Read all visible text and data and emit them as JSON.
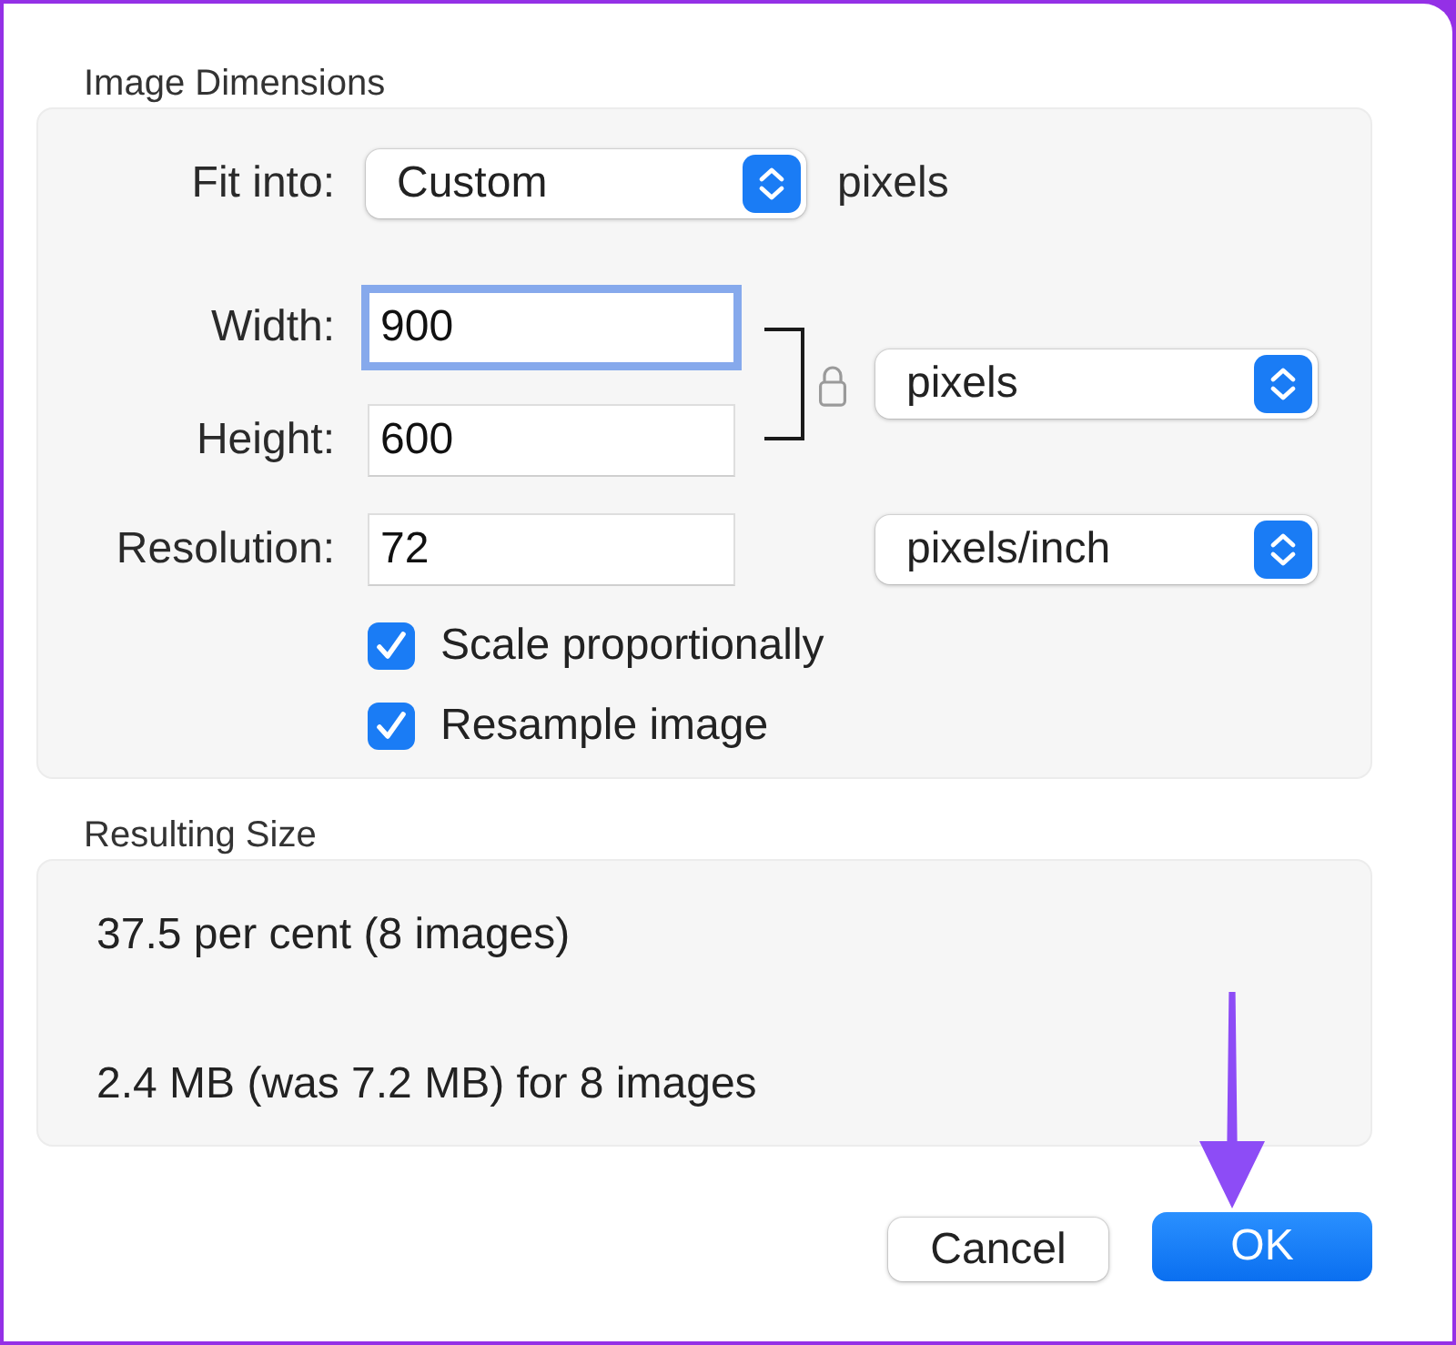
{
  "image_dimensions": {
    "title": "Image Dimensions",
    "fit_into": {
      "label": "Fit into:",
      "value": "Custom",
      "suffix": "pixels"
    },
    "fields": [
      {
        "label": "Width:",
        "value": "900",
        "focused": true
      },
      {
        "label": "Height:",
        "value": "600",
        "focused": false
      },
      {
        "label": "Resolution:",
        "value": "72",
        "focused": false
      }
    ],
    "size_unit": "pixels",
    "resolution_unit": "pixels/inch",
    "options": [
      {
        "label": "Scale proportionally",
        "checked": true
      },
      {
        "label": "Resample image",
        "checked": true
      }
    ]
  },
  "resulting_size": {
    "title": "Resulting Size",
    "lines": [
      "37.5 per cent (8 images)",
      "2.4 MB (was 7.2 MB) for 8 images"
    ]
  },
  "buttons": [
    {
      "label": "Cancel",
      "kind": "secondary"
    },
    {
      "label": "OK",
      "kind": "default"
    }
  ]
}
